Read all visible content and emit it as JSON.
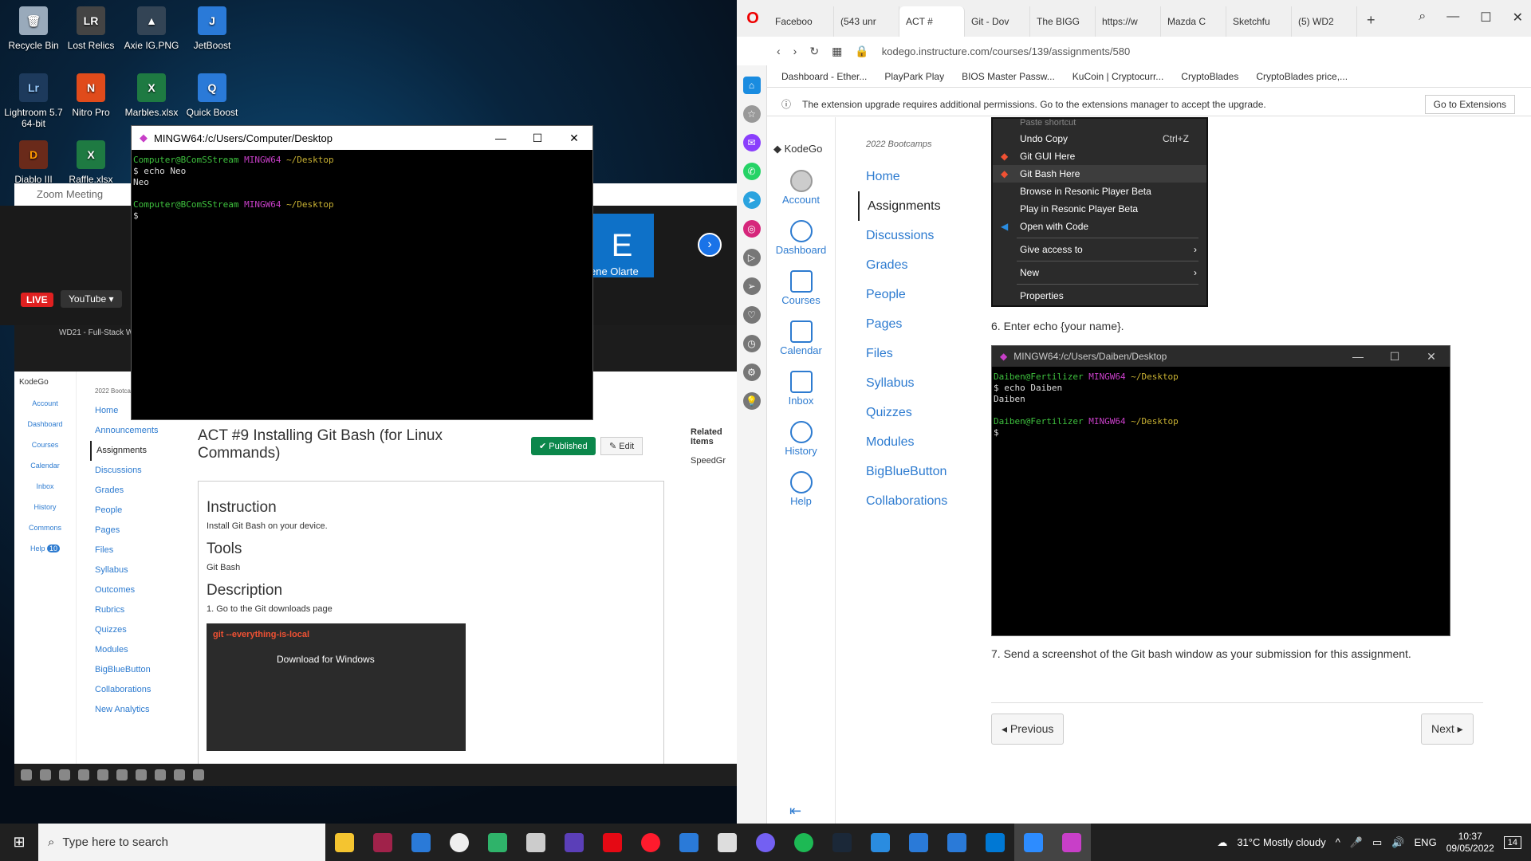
{
  "desktop": {
    "icons": [
      {
        "label": "Recycle Bin",
        "color": "#9ab"
      },
      {
        "label": "Lost Relics",
        "color": "#444"
      },
      {
        "label": "Axie IG.PNG",
        "color": "#345"
      },
      {
        "label": "JetBoost",
        "color": "#2a7ad8"
      },
      {
        "label": "Lightroom 5.7 64-bit",
        "color": "#1d3a5c"
      },
      {
        "label": "Nitro Pro",
        "color": "#e04b1b"
      },
      {
        "label": "Marbles.xlsx",
        "color": "#1e7a42"
      },
      {
        "label": "Quick Boost",
        "color": "#2a7ad8"
      },
      {
        "label": "Diablo III",
        "color": "#6a2a1a"
      },
      {
        "label": "Raffle.xlsx",
        "color": "#1e7a42"
      }
    ]
  },
  "zoom": {
    "title": "Zoom Meeting",
    "tile_letter": "E",
    "participant": "ene Olarte",
    "live": "LIVE",
    "youtube": "YouTube ▾"
  },
  "inner_page": {
    "tab": "WD21 - Full-Stack W",
    "brand": "KodeGo",
    "nav": [
      "Account",
      "Dashboard",
      "Courses",
      "Calendar",
      "Inbox",
      "History",
      "Commons",
      "Help"
    ],
    "course_caption": "2022 Bootcamps",
    "course_links": [
      "Home",
      "Announcements",
      "Assignments",
      "Discussions",
      "Grades",
      "People",
      "Pages",
      "Files",
      "Syllabus",
      "Outcomes",
      "Rubrics",
      "Quizzes",
      "Modules",
      "BigBlueButton",
      "Collaborations",
      "New Analytics"
    ],
    "title": "ACT #9 Installing Git Bash (for Linux Commands)",
    "published": "Published",
    "edit": "Edit",
    "related": "Related Items",
    "speedgrader": "SpeedGr",
    "instruction_h": "Instruction",
    "instruction": "Install Git Bash on your device.",
    "tools_h": "Tools",
    "tools": "Git Bash",
    "desc_h": "Description",
    "step1": "1. Go to the Git downloads page",
    "git_header": "git --everything-is-local",
    "git_download": "Download for Windows",
    "help_badge": "10"
  },
  "terminal_front": {
    "title": "MINGW64:/c/Users/Computer/Desktop",
    "user": "Computer@BComSStream",
    "env": "MINGW64",
    "path": "~/Desktop",
    "cmd": "$ echo Neo",
    "out": "Neo",
    "prompt": "$"
  },
  "browser": {
    "tabs": [
      "Faceboo",
      "(543 unr",
      "ACT #",
      "Git - Dov",
      "The BIGG",
      "https://w",
      "Mazda C",
      "Sketchfu",
      "(5) WD2"
    ],
    "url": "kodego.instructure.com/courses/139/assignments/580",
    "bookmarks": [
      "Dashboard - Ether...",
      "PlayPark Play",
      "BIOS Master Passw...",
      "KuCoin | Cryptocurr...",
      "CryptoBlades",
      "CryptoBlades price,..."
    ],
    "ext_notice": "The extension upgrade requires additional permissions. Go to the extensions manager to accept the upgrade.",
    "ext_button": "Go to Extensions"
  },
  "canvas": {
    "brand": "KodeGo",
    "global_nav": [
      "Account",
      "Dashboard",
      "Courses",
      "Calendar",
      "Inbox",
      "History",
      "Help"
    ],
    "course_caption": "2022 Bootcamps",
    "course_nav": [
      "Home",
      "Assignments",
      "Discussions",
      "Grades",
      "People",
      "Pages",
      "Files",
      "Syllabus",
      "Quizzes",
      "Modules",
      "BigBlueButton",
      "Collaborations"
    ],
    "context_menu": {
      "items": [
        {
          "label": "Paste shortcut",
          "shortcut": ""
        },
        {
          "label": "Undo Copy",
          "shortcut": "Ctrl+Z"
        },
        {
          "label": "Git GUI Here",
          "shortcut": ""
        },
        {
          "label": "Git Bash Here",
          "shortcut": ""
        },
        {
          "label": "Browse in Resonic Player Beta",
          "shortcut": ""
        },
        {
          "label": "Play in Resonic Player Beta",
          "shortcut": ""
        },
        {
          "label": "Open with Code",
          "shortcut": ""
        },
        {
          "label": "Give access to",
          "shortcut": ""
        },
        {
          "label": "New",
          "shortcut": ""
        },
        {
          "label": "Properties",
          "shortcut": ""
        }
      ]
    },
    "step6": "6. Enter echo {your name}.",
    "step7": "7. Send a screenshot of the Git bash window as your submission for this assignment.",
    "previous": "◂ Previous",
    "next": "Next ▸"
  },
  "terminal_embedded": {
    "title": "MINGW64:/c/Users/Daiben/Desktop",
    "user": "Daiben@Fertilizer",
    "env": "MINGW64",
    "path": "~/Desktop",
    "cmd": "$ echo Daiben",
    "out": "Daiben",
    "prompt": "$"
  },
  "taskbar": {
    "search_placeholder": "Type here to search",
    "weather": "31°C  Mostly cloudy",
    "lang": "ENG",
    "time": "10:37",
    "date": "09/05/2022",
    "notif": "14"
  }
}
